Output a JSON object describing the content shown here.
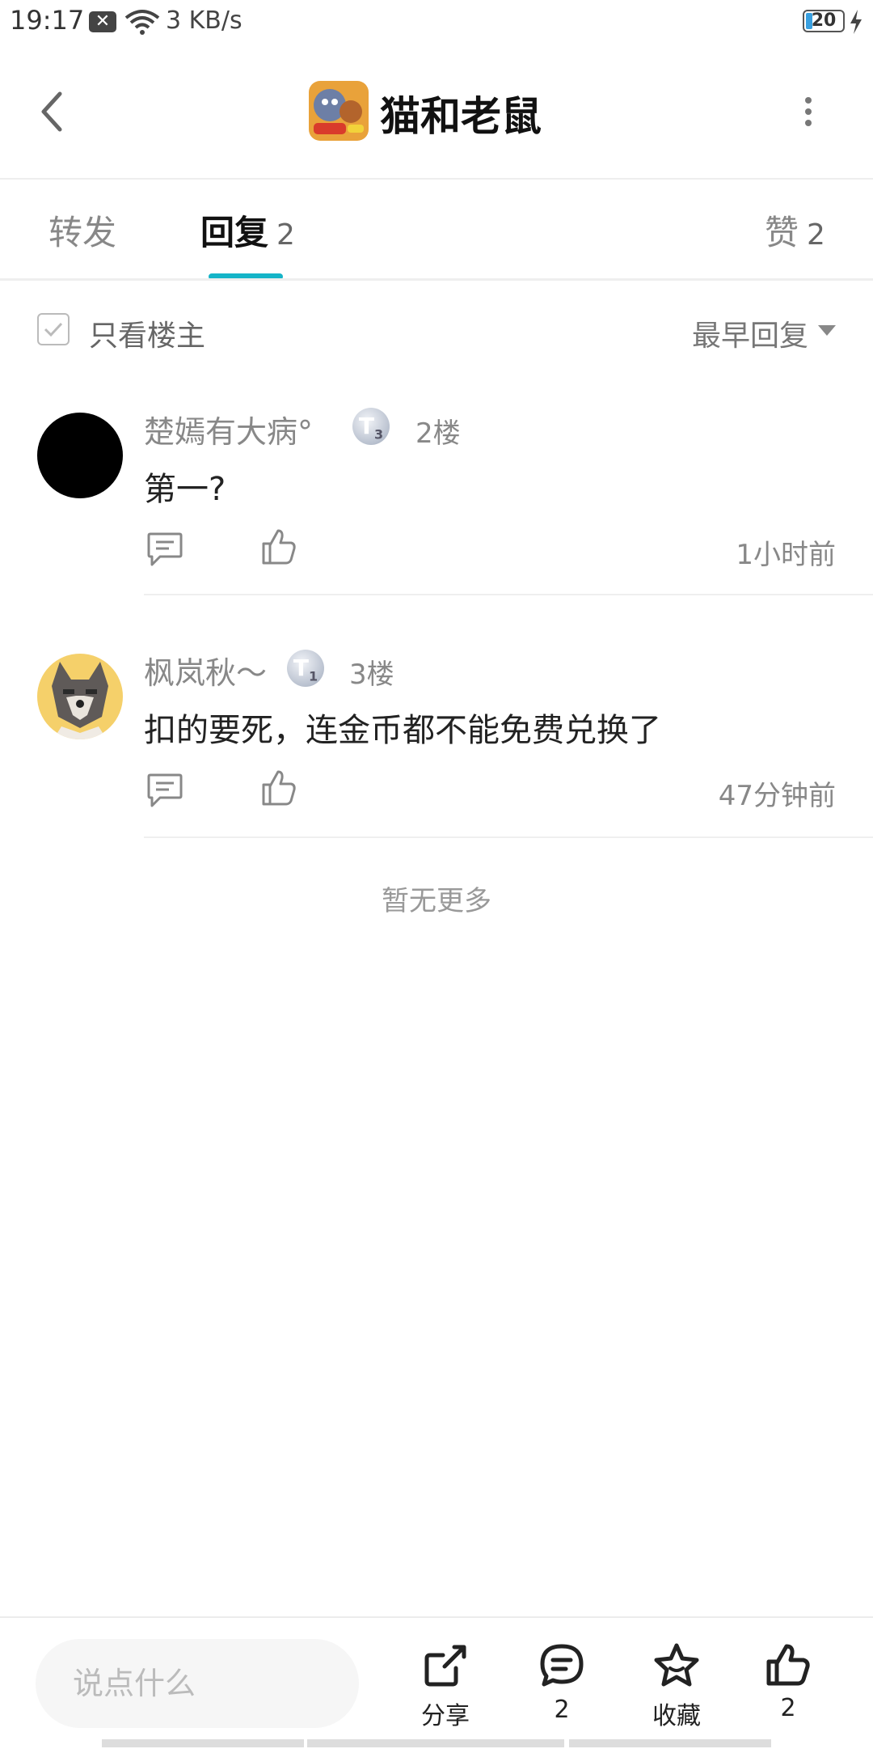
{
  "status_bar": {
    "time": "19:17",
    "network_speed": "3 KB/s",
    "battery": "20"
  },
  "header": {
    "title": "猫和老鼠",
    "back_icon": "chevron-left-icon",
    "more_icon": "more-vertical-icon"
  },
  "tabs": [
    {
      "label": "转发",
      "count": ""
    },
    {
      "label": "回复",
      "count": "2",
      "active": true
    },
    {
      "label": "赞",
      "count": "2"
    }
  ],
  "filter": {
    "only_op_label": "只看楼主",
    "sort_label": "最早回复"
  },
  "comments": [
    {
      "user": "楚嫣有大病°",
      "badge": "T",
      "badge_sub": "3",
      "floor": "2楼",
      "text": "第一?",
      "time": "1小时前"
    },
    {
      "user": "枫岚秋～",
      "badge": "T",
      "badge_sub": "1",
      "floor": "3楼",
      "text": "扣的要死，连金币都不能免费兑换了",
      "time": "47分钟前"
    }
  ],
  "no_more": "暂无更多",
  "bottom_bar": {
    "input_placeholder": "说点什么",
    "share_label": "分享",
    "comment_count": "2",
    "favorite_label": "收藏",
    "like_count": "2"
  },
  "colors": {
    "accent": "#15b4c8"
  }
}
